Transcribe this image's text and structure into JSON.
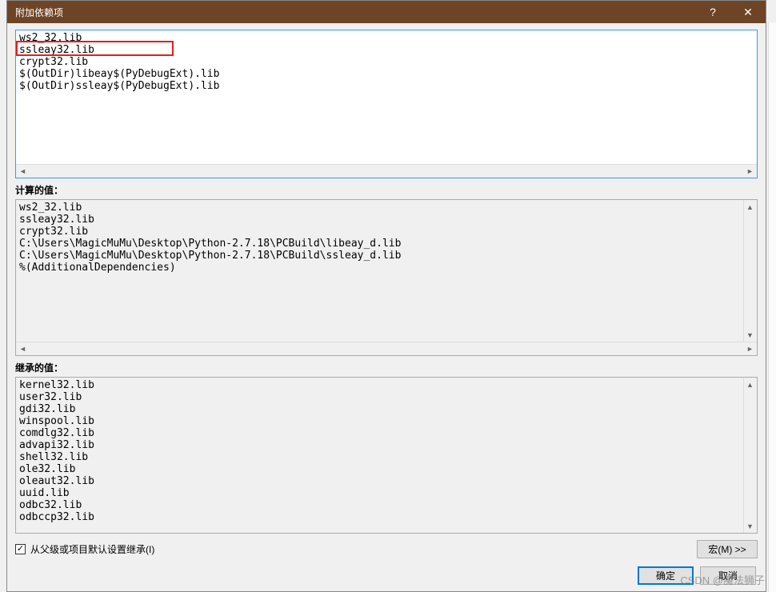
{
  "title": "附加依赖项",
  "editable_lines": "ws2_32.lib\nssleay32.lib\ncrypt32.lib\n$(OutDir)libeay$(PyDebugExt).lib\n$(OutDir)ssleay$(PyDebugExt).lib",
  "computed_label": "计算的值：",
  "computed_lines": "ws2_32.lib\nssleay32.lib\ncrypt32.lib\nC:\\Users\\MagicMuMu\\Desktop\\Python-2.7.18\\PCBuild\\libeay_d.lib\nC:\\Users\\MagicMuMu\\Desktop\\Python-2.7.18\\PCBuild\\ssleay_d.lib\n%(AdditionalDependencies)",
  "inherited_label": "继承的值：",
  "inherited_lines": "kernel32.lib\nuser32.lib\ngdi32.lib\nwinspool.lib\ncomdlg32.lib\nadvapi32.lib\nshell32.lib\nole32.lib\noleaut32.lib\nuuid.lib\nodbc32.lib\nodbccp32.lib",
  "inherit_checkbox_label": "从父级或项目默认设置继承(I)",
  "inherit_checked": "✓",
  "macro_button": "宏(M) >>",
  "ok_button": "确定",
  "cancel_button": "取消",
  "help_glyph": "?",
  "close_glyph": "✕",
  "watermark": "CSDN @魔法狮子"
}
